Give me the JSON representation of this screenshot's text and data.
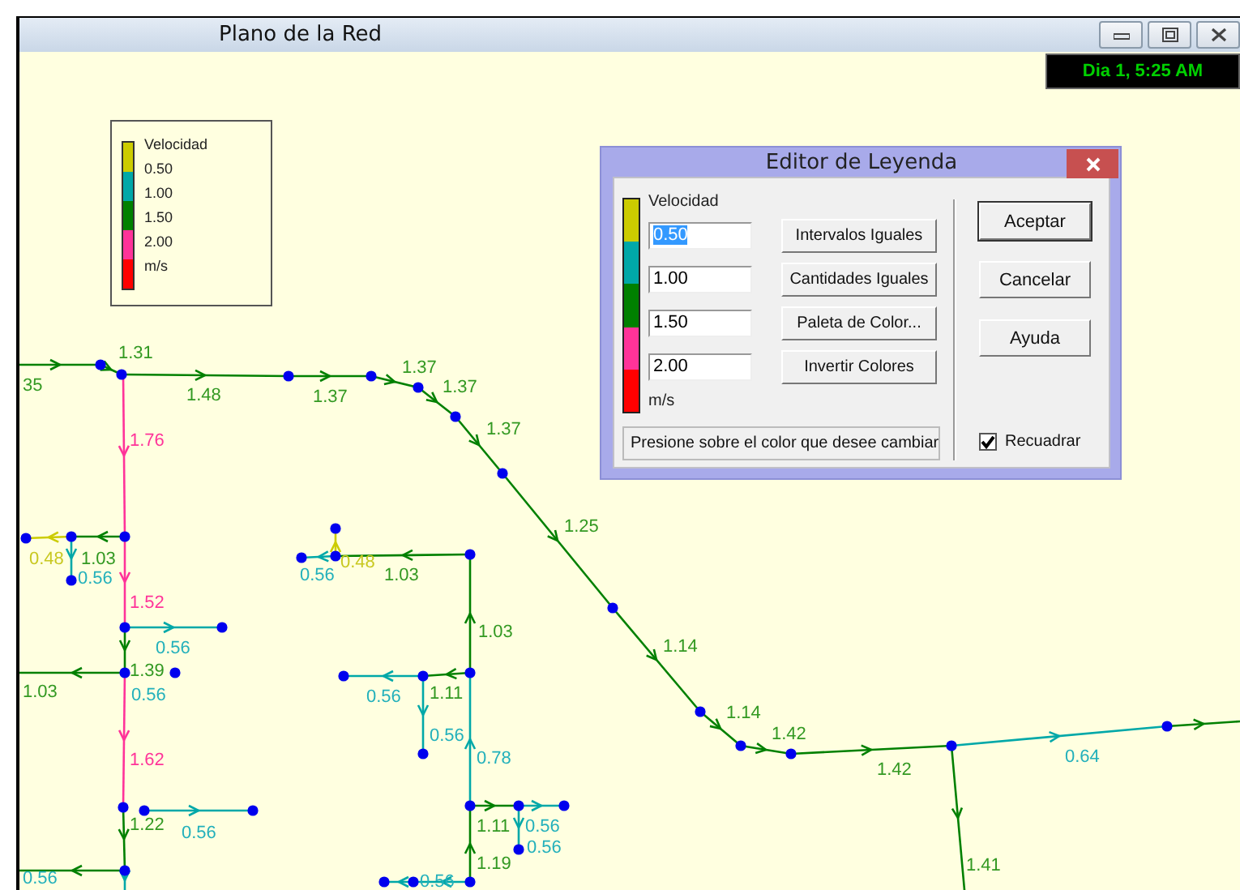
{
  "window": {
    "title": "Plano de la Red",
    "clock": "Dia 1, 5:25 AM"
  },
  "legend": {
    "title": "Velocidad",
    "unit": "m/s",
    "colors": [
      {
        "color": "#cccc00"
      },
      {
        "color": "#00a8a8"
      },
      {
        "color": "#008000"
      },
      {
        "color": "#ff3399"
      },
      {
        "color": "#ff0000"
      }
    ],
    "values": [
      "0.50",
      "1.00",
      "1.50",
      "2.00"
    ]
  },
  "map": {
    "links": [
      {
        "color": "#008000"
      },
      {
        "color": "#008000"
      },
      {
        "color": "#008000"
      },
      {
        "color": "#008000"
      },
      {
        "color": "#008000"
      },
      {
        "color": "#008000"
      },
      {
        "color": "#008000"
      },
      {
        "color": "#008000"
      },
      {
        "color": "#008000"
      },
      {
        "color": "#008000"
      },
      {
        "color": "#008000"
      },
      {
        "color": "#008000"
      },
      {
        "color": "#00a8a8"
      },
      {
        "color": "#008000"
      },
      {
        "color": "#008000"
      },
      {
        "color": "#ff3399"
      },
      {
        "color": "#ff3399"
      },
      {
        "color": "#008000"
      },
      {
        "color": "#ff3399"
      },
      {
        "color": "#008000"
      },
      {
        "color": "#00a8a8"
      },
      {
        "color": "#008000"
      },
      {
        "color": "#cccc00"
      },
      {
        "color": "#00a8a8"
      },
      {
        "color": "#00a8a8"
      },
      {
        "color": "#008000"
      },
      {
        "color": "#00a8a8"
      },
      {
        "color": "#008000"
      },
      {
        "color": "#008000"
      },
      {
        "color": "#cccc00"
      },
      {
        "color": "#00a8a8"
      },
      {
        "color": "#008000"
      },
      {
        "color": "#008000"
      },
      {
        "color": "#00a8a8"
      },
      {
        "color": "#00a8a8"
      },
      {
        "color": "#00a8a8"
      },
      {
        "color": "#008000"
      },
      {
        "color": "#00a8a8"
      },
      {
        "color": "#00a8a8"
      },
      {
        "color": "#008000"
      },
      {
        "color": "#00a8a8"
      },
      {
        "color": "#00a8a8"
      }
    ],
    "labels": [
      {
        "text": "1.31",
        "color": "#339922"
      },
      {
        "text": "35",
        "color": "#339922"
      },
      {
        "text": "1.48",
        "color": "#339922"
      },
      {
        "text": "1.37",
        "color": "#339922"
      },
      {
        "text": "1.37",
        "color": "#339922"
      },
      {
        "text": "1.37",
        "color": "#339922"
      },
      {
        "text": "1.37",
        "color": "#339922"
      },
      {
        "text": "1.25",
        "color": "#339922"
      },
      {
        "text": "1.14",
        "color": "#339922"
      },
      {
        "text": "1.14",
        "color": "#339922"
      },
      {
        "text": "1.42",
        "color": "#339922"
      },
      {
        "text": "1.42",
        "color": "#339922"
      },
      {
        "text": "0.64",
        "color": "#22b0bb"
      },
      {
        "text": "1.41",
        "color": "#339922"
      },
      {
        "text": "1.76",
        "color": "#ff3399"
      },
      {
        "text": "1.52",
        "color": "#ff3399"
      },
      {
        "text": "1.62",
        "color": "#ff3399"
      },
      {
        "text": "0.48",
        "color": "#c8c820"
      },
      {
        "text": "1.03",
        "color": "#339922"
      },
      {
        "text": "0.56",
        "color": "#22b0bb"
      },
      {
        "text": "0.56",
        "color": "#22b0bb"
      },
      {
        "text": "1.03",
        "color": "#339922"
      },
      {
        "text": "1.39",
        "color": "#339922"
      },
      {
        "text": "0.56",
        "color": "#22b0bb"
      },
      {
        "text": "1.22",
        "color": "#339922"
      },
      {
        "text": "0.56",
        "color": "#22b0bb"
      },
      {
        "text": "0.56",
        "color": "#22b0bb"
      },
      {
        "text": "0.56",
        "color": "#22b0bb"
      },
      {
        "text": "0.48",
        "color": "#c8c820"
      },
      {
        "text": "1.03",
        "color": "#339922"
      },
      {
        "text": "1.03",
        "color": "#339922"
      },
      {
        "text": "0.56",
        "color": "#22b0bb"
      },
      {
        "text": "1.11",
        "color": "#339922"
      },
      {
        "text": "0.56",
        "color": "#22b0bb"
      },
      {
        "text": "0.78",
        "color": "#22b0bb"
      },
      {
        "text": "1.11",
        "color": "#339922"
      },
      {
        "text": "0.56",
        "color": "#22b0bb"
      },
      {
        "text": "0.56",
        "color": "#22b0bb"
      },
      {
        "text": "1.19",
        "color": "#339922"
      },
      {
        "text": "0.56",
        "color": "#22b0bb"
      }
    ]
  },
  "dialog": {
    "title": "Editor de Leyenda",
    "field_label": "Velocidad",
    "unit": "m/s",
    "colors": [
      {
        "color": "#cccc00"
      },
      {
        "color": "#00a8a8"
      },
      {
        "color": "#008000"
      },
      {
        "color": "#ff3399"
      },
      {
        "color": "#ff0000"
      }
    ],
    "fields": [
      {
        "value": "0.50",
        "selected": true
      },
      {
        "value": "1.00",
        "selected": false
      },
      {
        "value": "1.50",
        "selected": false
      },
      {
        "value": "2.00",
        "selected": false
      }
    ],
    "buttons": [
      "Intervalos Iguales",
      "Cantidades Iguales",
      "Paleta de Color...",
      "Invertir Colores"
    ],
    "side_buttons": [
      {
        "label": "Aceptar",
        "default": true
      },
      {
        "label": "Cancelar",
        "default": false
      },
      {
        "label": "Ayuda",
        "default": false
      }
    ],
    "hint": "Presione sobre el color que desee cambiar",
    "checkbox": {
      "label": "Recuadrar",
      "checked": true
    }
  }
}
